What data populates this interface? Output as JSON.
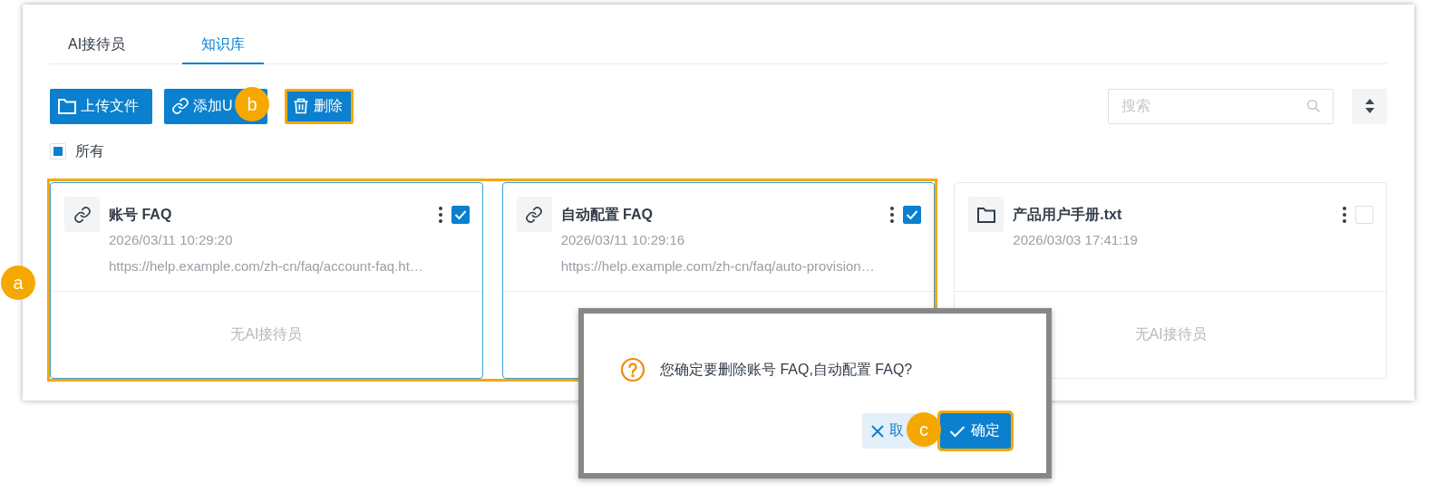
{
  "tabs": [
    {
      "label": "AI接待员",
      "selected": false
    },
    {
      "label": "知识库",
      "selected": true
    }
  ],
  "toolbar": {
    "buttons": [
      {
        "kind": "upload",
        "label": "上传文件",
        "highlighted": false
      },
      {
        "kind": "link",
        "label": "添加U",
        "highlighted": false
      },
      {
        "kind": "delete",
        "label": "删除",
        "highlighted": true
      }
    ],
    "search": {
      "placeholder": "搜索"
    }
  },
  "select_all": {
    "label": "所有",
    "indeterminate": true
  },
  "cards": [
    {
      "kind": "link",
      "title": "账号 FAQ",
      "date": "2026/03/11 10:29:20",
      "url": "https://help.example.com/zh-cn/faq/account-faq.ht…",
      "footer": "无AI接待员",
      "checked": true,
      "highlighted": true
    },
    {
      "kind": "link",
      "title": "自动配置 FAQ",
      "date": "2026/03/11 10:29:16",
      "url": "https://help.example.com/zh-cn/faq/auto-provision…",
      "checked": true,
      "highlighted": true
    },
    {
      "kind": "file",
      "title": "产品用户手册.txt",
      "date": "2026/03/03 17:41:19",
      "footer": "无AI接待员",
      "checked": false,
      "highlighted": false
    }
  ],
  "dialog": {
    "message": "您确定要删除账号 FAQ,自动配置 FAQ?",
    "buttons": [
      {
        "kind": "cancel",
        "label": "取",
        "highlighted": false
      },
      {
        "kind": "confirm",
        "label": "确定",
        "highlighted": true
      }
    ]
  },
  "callouts": [
    {
      "label": "a"
    },
    {
      "label": "b"
    },
    {
      "label": "c"
    }
  ]
}
